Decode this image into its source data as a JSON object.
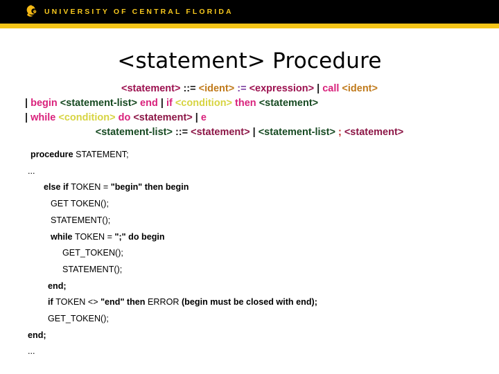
{
  "header": {
    "wordmark": "UNIVERSITY OF CENTRAL FLORIDA",
    "logo_icon": "pegasus-icon",
    "band_color": "#000000",
    "rule_color": "#F5C518",
    "wordmark_color": "#F7C81E"
  },
  "title": "<statement> Procedure",
  "colors": {
    "statement_pink": "#9C1250",
    "ident_orange": "#C07A1B",
    "assign_purple": "#7B3FA0",
    "keyword_pink": "#D9227C",
    "statement_green": "#174A22",
    "condition_yellow": "#D7D442",
    "statement_maroon": "#8C1646",
    "semicolon_red": "#C22B2B",
    "plain_black": "#1a1a1a"
  },
  "grammar": {
    "lines": [
      {
        "id": "grammar-line-1",
        "align": "left-center",
        "tokens": [
          {
            "t": "<statement>",
            "c": "tk-stmt-pink"
          },
          {
            "t": " ::= ",
            "c": "tk-plain"
          },
          {
            "t": "<ident>",
            "c": "tk-ident"
          },
          {
            "t": " ",
            "c": "tk-plain"
          },
          {
            "t": ":=",
            "c": "tk-assign"
          },
          {
            "t": " ",
            "c": "tk-plain"
          },
          {
            "t": "<expression>",
            "c": "tk-stmt-pink"
          },
          {
            "t": " | ",
            "c": "tk-bar"
          },
          {
            "t": "call",
            "c": "tk-kw"
          },
          {
            "t": " ",
            "c": "tk-plain"
          },
          {
            "t": "<ident>",
            "c": "tk-ident"
          }
        ]
      },
      {
        "id": "grammar-line-2",
        "align": "indent",
        "tokens": [
          {
            "t": "| ",
            "c": "tk-bar"
          },
          {
            "t": "begin",
            "c": "tk-kw"
          },
          {
            "t": " ",
            "c": "tk-plain"
          },
          {
            "t": "<statement-list>",
            "c": "tk-stmt-green"
          },
          {
            "t": " ",
            "c": "tk-plain"
          },
          {
            "t": "end",
            "c": "tk-kw"
          },
          {
            "t": " | ",
            "c": "tk-bar"
          },
          {
            "t": "if",
            "c": "tk-kw"
          },
          {
            "t": " ",
            "c": "tk-plain"
          },
          {
            "t": "<condition>",
            "c": "tk-cond"
          },
          {
            "t": " ",
            "c": "tk-plain"
          },
          {
            "t": "then",
            "c": "tk-kw"
          },
          {
            "t": " ",
            "c": "tk-plain"
          },
          {
            "t": "<statement>",
            "c": "tk-stmt-green"
          }
        ]
      },
      {
        "id": "grammar-line-3",
        "align": "indent",
        "tokens": [
          {
            "t": "| ",
            "c": "tk-bar"
          },
          {
            "t": "while",
            "c": "tk-kw"
          },
          {
            "t": " ",
            "c": "tk-plain"
          },
          {
            "t": "<condition>",
            "c": "tk-cond"
          },
          {
            "t": " ",
            "c": "tk-plain"
          },
          {
            "t": "do",
            "c": "tk-kw"
          },
          {
            "t": " ",
            "c": "tk-plain"
          },
          {
            "t": "<statement>",
            "c": "tk-stmt-maroon"
          },
          {
            "t": " | ",
            "c": "tk-bar"
          },
          {
            "t": "e",
            "c": "tk-kw"
          }
        ]
      },
      {
        "id": "grammar-line-4",
        "align": "left-center",
        "tokens": [
          {
            "t": "<statement-list>",
            "c": "tk-stmt-green"
          },
          {
            "t": " ::= ",
            "c": "tk-plain"
          },
          {
            "t": "<statement>",
            "c": "tk-stmt-maroon"
          },
          {
            "t": " | ",
            "c": "tk-bar"
          },
          {
            "t": "<statement-list>",
            "c": "tk-stmt-green"
          },
          {
            "t": " ",
            "c": "tk-plain"
          },
          {
            "t": ";",
            "c": "tk-semi"
          },
          {
            "t": " ",
            "c": "tk-plain"
          },
          {
            "t": "<statement>",
            "c": "tk-stmt-maroon"
          }
        ]
      }
    ]
  },
  "code": {
    "lines": [
      {
        "id": "code-line-1",
        "indent": "ind0",
        "parts": [
          {
            "t": "procedure ",
            "b": true
          },
          {
            "t": "STATEMENT;",
            "b": false
          }
        ]
      },
      {
        "id": "code-line-2",
        "indent": "ind1",
        "parts": [
          {
            "t": "...",
            "b": false
          }
        ]
      },
      {
        "id": "code-line-3",
        "indent": "ind2",
        "parts": [
          {
            "t": "else if ",
            "b": true
          },
          {
            "t": "TOKEN = ",
            "b": false
          },
          {
            "t": "\"begin\" then begin",
            "b": true
          }
        ]
      },
      {
        "id": "code-line-4",
        "indent": "ind3",
        "parts": [
          {
            "t": "GET TOKEN();",
            "b": false
          }
        ]
      },
      {
        "id": "code-line-5",
        "indent": "ind3",
        "parts": [
          {
            "t": "STATEMENT();",
            "b": false
          }
        ]
      },
      {
        "id": "code-line-6",
        "indent": "ind3",
        "parts": [
          {
            "t": "while ",
            "b": true
          },
          {
            "t": "TOKEN = ",
            "b": false
          },
          {
            "t": "\";\" do begin",
            "b": true
          }
        ]
      },
      {
        "id": "code-line-7",
        "indent": "ind4",
        "parts": [
          {
            "t": "GET_TOKEN();",
            "b": false
          }
        ]
      },
      {
        "id": "code-line-8",
        "indent": "ind4",
        "parts": [
          {
            "t": "STATEMENT();",
            "b": false
          }
        ]
      },
      {
        "id": "code-line-9",
        "indent": "ind5",
        "parts": [
          {
            "t": "end;",
            "b": true
          }
        ]
      },
      {
        "id": "code-line-10",
        "indent": "ind5",
        "parts": [
          {
            "t": "if ",
            "b": true
          },
          {
            "t": "TOKEN <> ",
            "b": false
          },
          {
            "t": "\"end\" then ",
            "b": true
          },
          {
            "t": "ERROR ",
            "b": false
          },
          {
            "t": "(begin must be closed with end);",
            "b": true
          }
        ]
      },
      {
        "id": "code-line-11",
        "indent": "ind5",
        "parts": [
          {
            "t": "GET_TOKEN();",
            "b": false
          }
        ]
      },
      {
        "id": "code-line-12",
        "indent": "ind6",
        "parts": [
          {
            "t": "end;",
            "b": true
          }
        ]
      },
      {
        "id": "code-line-13",
        "indent": "ind1",
        "parts": [
          {
            "t": "...",
            "b": false
          }
        ]
      }
    ]
  }
}
